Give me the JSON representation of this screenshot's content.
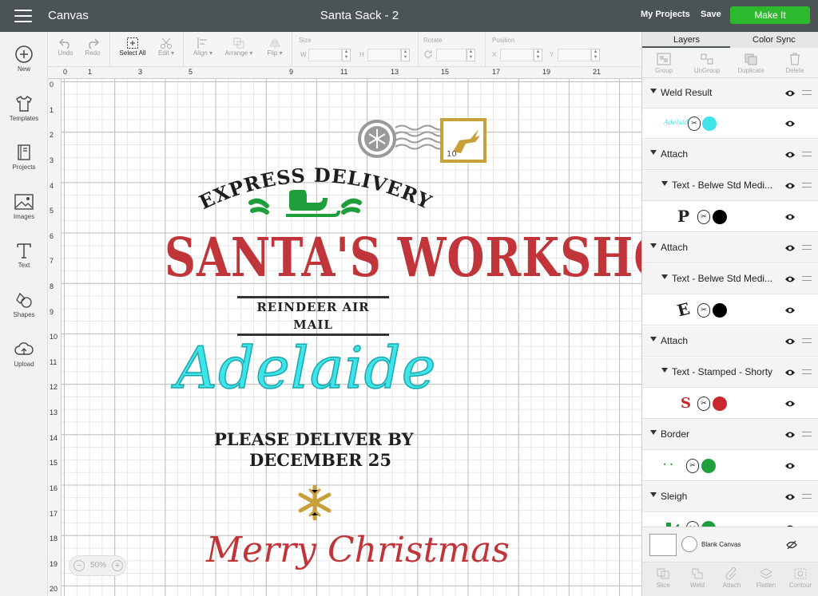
{
  "topbar": {
    "app_name": "Canvas",
    "doc_title": "Santa Sack - 2",
    "my_projects": "My Projects",
    "save": "Save",
    "make_it": "Make It"
  },
  "leftbar": [
    {
      "label": "New",
      "icon": "plus-circle-icon"
    },
    {
      "label": "Templates",
      "icon": "shirt-icon"
    },
    {
      "label": "Projects",
      "icon": "book-icon"
    },
    {
      "label": "Images",
      "icon": "image-icon"
    },
    {
      "label": "Text",
      "icon": "text-icon"
    },
    {
      "label": "Shapes",
      "icon": "shapes-icon"
    },
    {
      "label": "Upload",
      "icon": "cloud-upload-icon"
    }
  ],
  "toolbar": {
    "undo": "Undo",
    "redo": "Redo",
    "select_all": "Select All",
    "edit": "Edit",
    "align": "Align",
    "arrange": "Arrange",
    "flip": "Flip",
    "size_label": "Size",
    "w_label": "W",
    "h_label": "H",
    "rotate_label": "Rotate",
    "position_label": "Position",
    "x_label": "X",
    "y_label": "Y"
  },
  "ruler": {
    "top": [
      "0",
      "1",
      "3",
      "5",
      "9",
      "11",
      "13",
      "15",
      "17",
      "19",
      "21"
    ],
    "left": [
      "0",
      "1",
      "2",
      "3",
      "4",
      "5",
      "6",
      "7",
      "8",
      "9",
      "10",
      "11",
      "12",
      "13",
      "14",
      "15",
      "16",
      "17",
      "18",
      "19",
      "20"
    ]
  },
  "zoom": {
    "value": "50%",
    "minus": "−",
    "plus": "+"
  },
  "design": {
    "express_delivery": "EXPRESS DELIVERY",
    "santas_workshop": "SANTA'S WORKSHOP",
    "reindeer_air_mail": "REINDEER AIR MAIL",
    "stamp_number": "10",
    "name": "Adelaide",
    "deliver_line1": "PLEASE DELIVER BY",
    "deliver_line2": "DECEMBER 25",
    "merry_christmas": "Merry Christmas",
    "colors": {
      "red": "#c0353a",
      "cyan": "#3fe4e8",
      "green": "#1f9e3c",
      "gold": "#c8a03a",
      "black": "#1e1e1e"
    }
  },
  "panel": {
    "tab_layers": "Layers",
    "tab_color_sync": "Color Sync",
    "actions": [
      "Group",
      "UnGroup",
      "Duplicate",
      "Delete"
    ],
    "layers": [
      {
        "type": "group",
        "name": "Weld Result"
      },
      {
        "type": "item",
        "thumb": "Adelaide",
        "swatch": "#3fe4e8"
      },
      {
        "type": "group",
        "name": "Attach"
      },
      {
        "type": "sub",
        "name": "Text - Belwe Std Medi..."
      },
      {
        "type": "item",
        "thumb": "P",
        "swatch": "#000000"
      },
      {
        "type": "group",
        "name": "Attach"
      },
      {
        "type": "sub",
        "name": "Text - Belwe Std Medi..."
      },
      {
        "type": "item",
        "thumb": "E",
        "swatch": "#000000"
      },
      {
        "type": "group",
        "name": "Attach"
      },
      {
        "type": "sub",
        "name": "Text - Stamped - Shorty"
      },
      {
        "type": "item",
        "thumb": "S",
        "swatch": "#c8282e"
      },
      {
        "type": "group",
        "name": "Border"
      },
      {
        "type": "item",
        "thumb": "· ·",
        "swatch": "#1f9e3c"
      },
      {
        "type": "group",
        "name": "Sleigh"
      },
      {
        "type": "item",
        "thumb": "sleigh",
        "swatch": "#1f9e3c"
      }
    ],
    "blank_canvas": "Blank Canvas",
    "bottom_actions": [
      "Slice",
      "Weld",
      "Attach",
      "Flatten",
      "Contour"
    ]
  }
}
